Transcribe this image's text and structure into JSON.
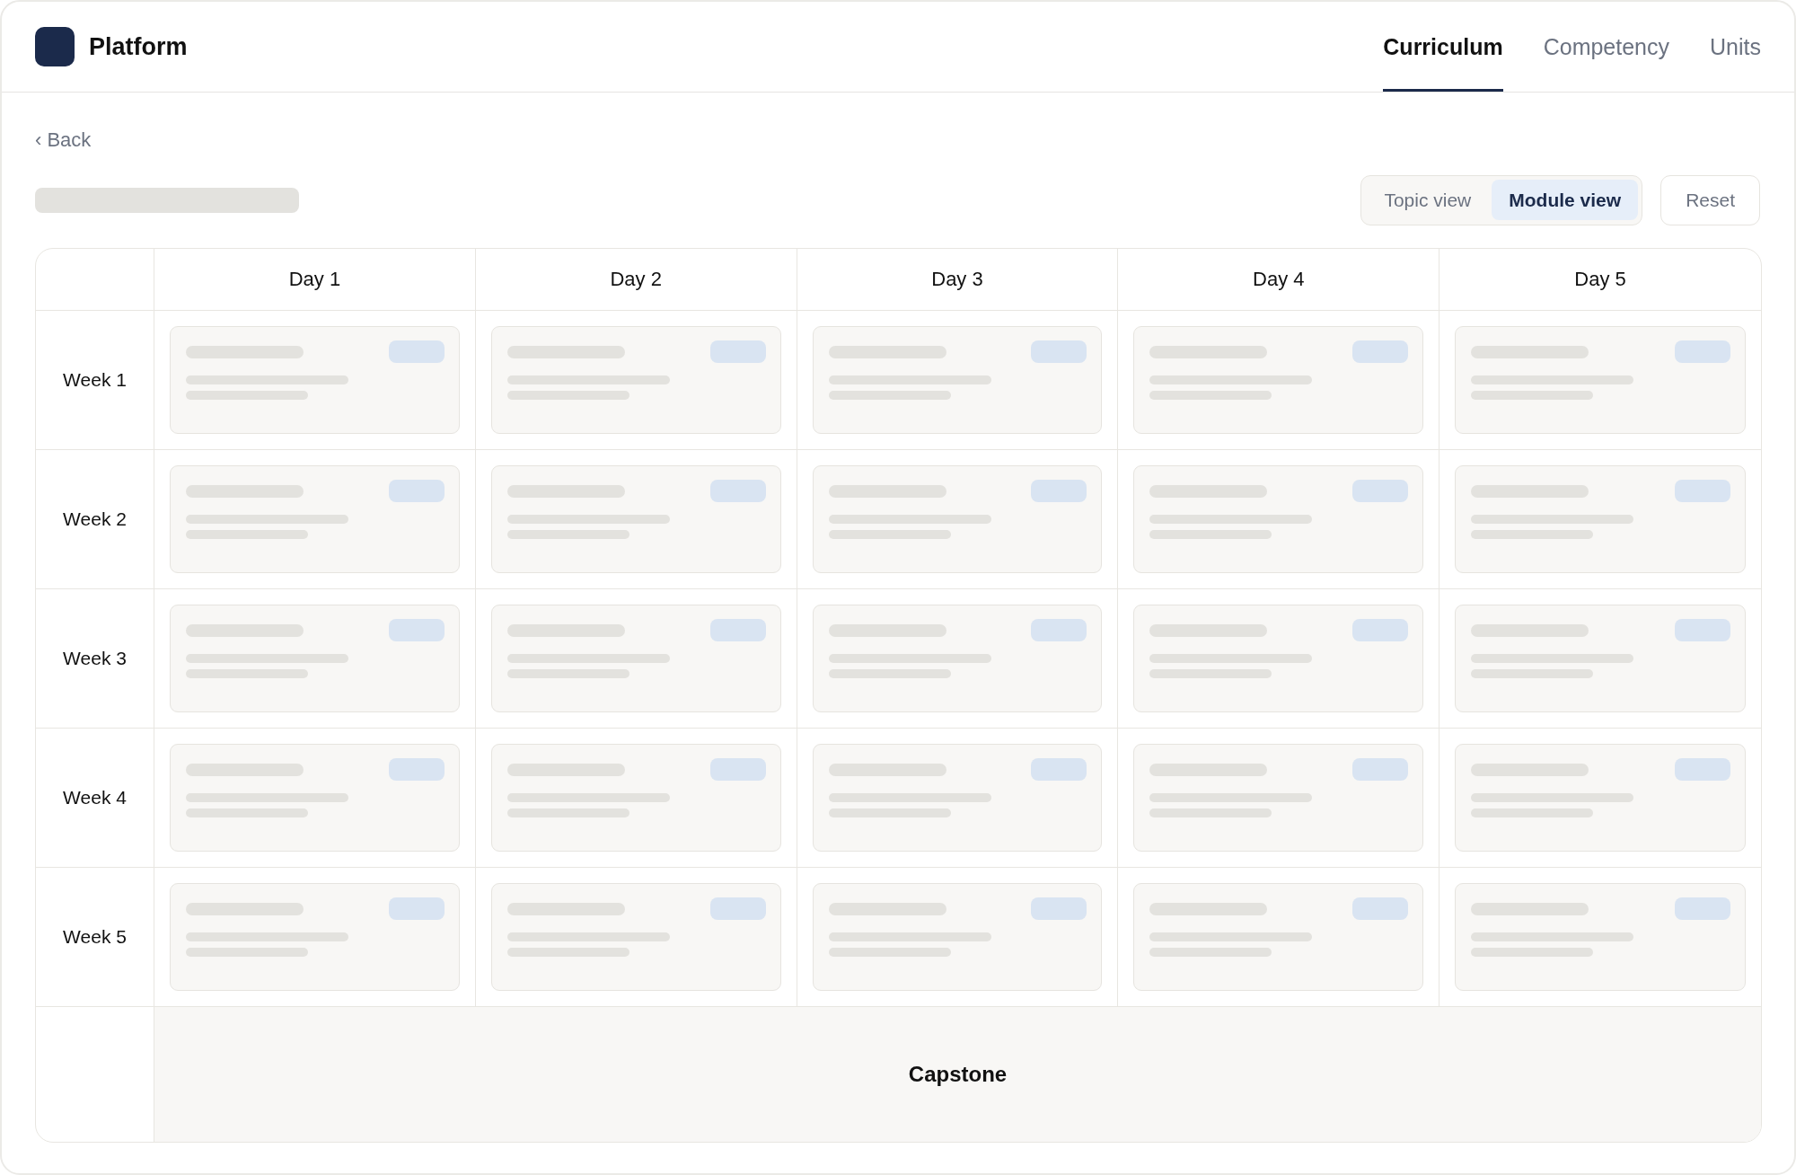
{
  "app": {
    "name": "Platform"
  },
  "tabs": [
    {
      "label": "Curriculum",
      "selected": true
    },
    {
      "label": "Competency",
      "selected": false
    },
    {
      "label": "Units",
      "selected": false
    }
  ],
  "back_link": "‹ Back",
  "view_toggle": [
    {
      "label": "Topic view",
      "selected": false
    },
    {
      "label": "Module view",
      "selected": true
    }
  ],
  "reset_button": "Reset",
  "schedule": {
    "columns": [
      "Day 1",
      "Day 2",
      "Day 3",
      "Day 4",
      "Day 5"
    ],
    "rows": [
      {
        "label": "Week 1"
      },
      {
        "label": "Week 2"
      },
      {
        "label": "Week 3"
      },
      {
        "label": "Week 4"
      },
      {
        "label": "Week 5"
      }
    ],
    "final_row": {
      "label": "Capstone"
    }
  }
}
